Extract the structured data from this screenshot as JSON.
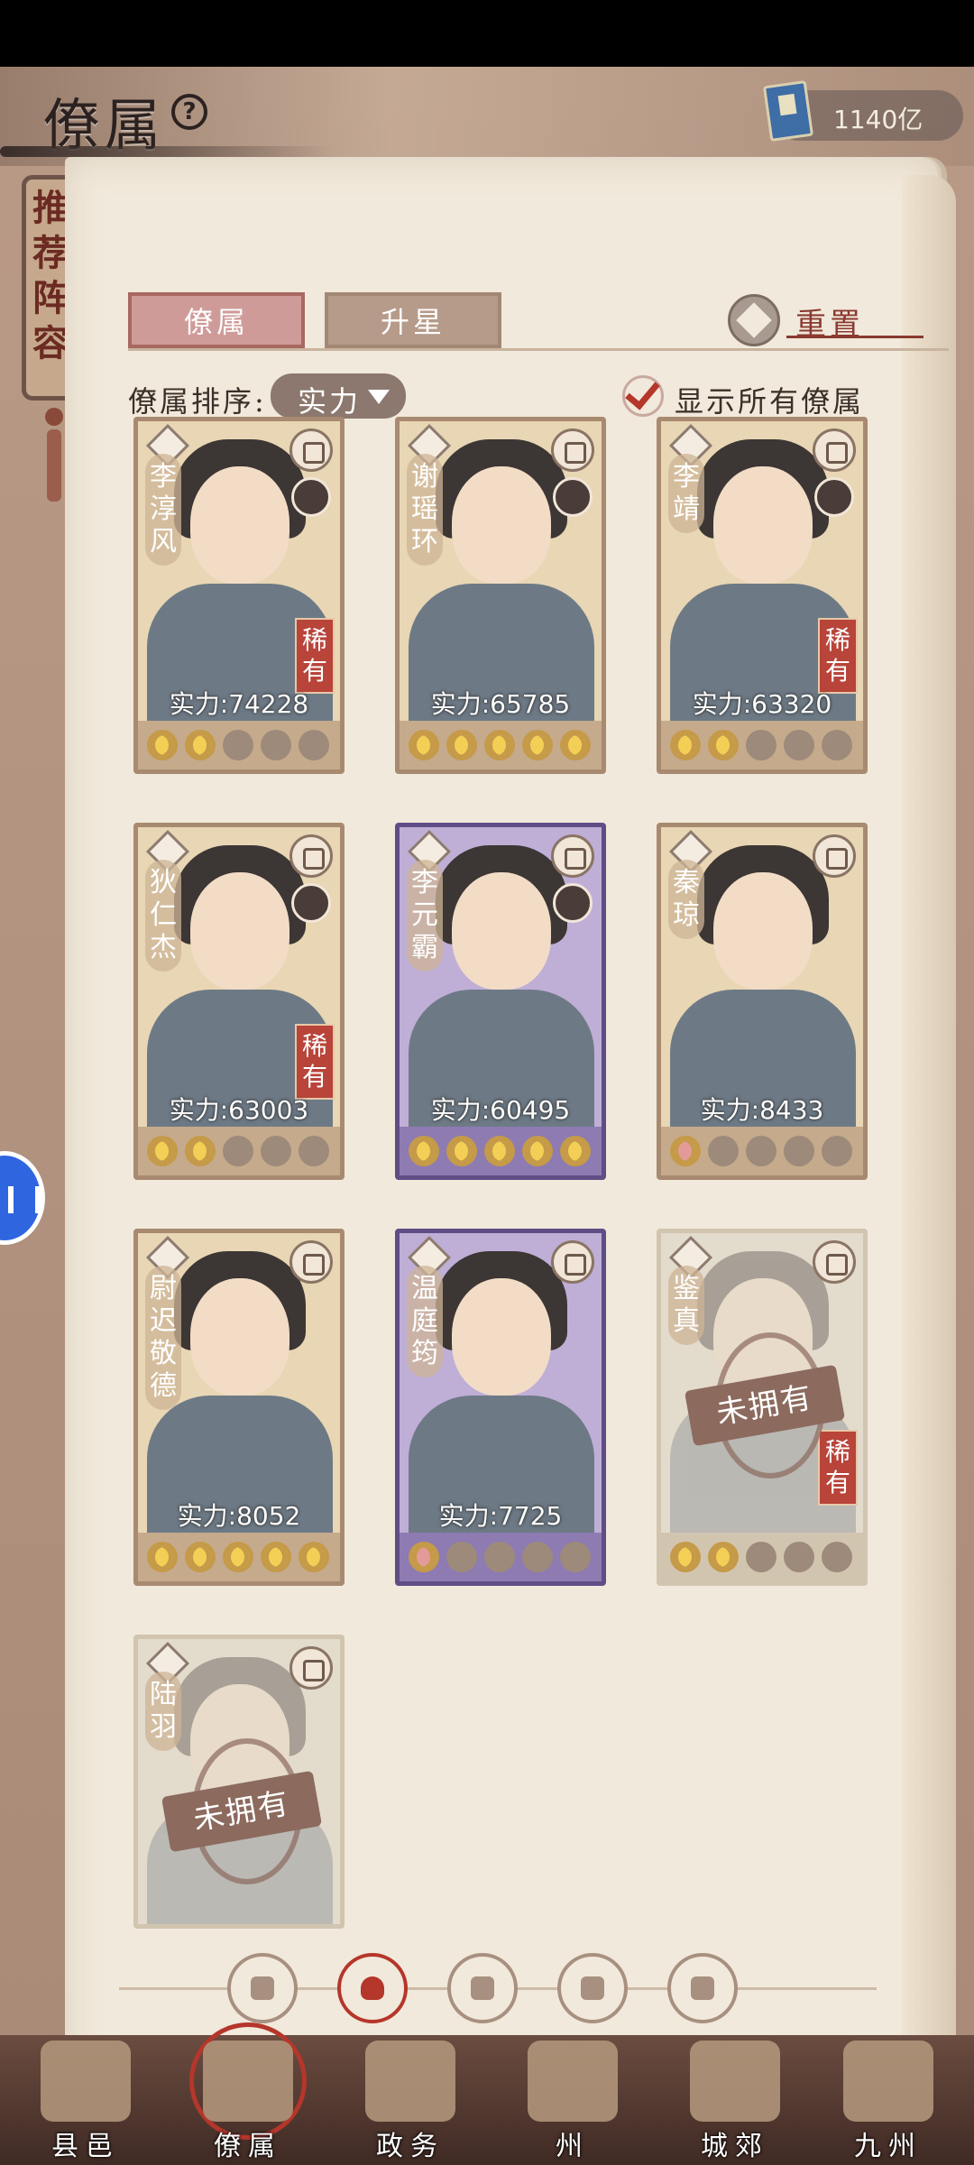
{
  "header": {
    "title": "僚属",
    "help": "?",
    "currency": {
      "icon": "book-icon",
      "value": "1140亿"
    }
  },
  "side_tag": {
    "text": "推荐阵容"
  },
  "tabs": [
    {
      "label": "僚属",
      "active": true
    },
    {
      "label": "升星",
      "active": false
    }
  ],
  "reset": {
    "label": "重置"
  },
  "sort": {
    "label": "僚属排序:",
    "value": "实力"
  },
  "show_all": {
    "label": "显示所有僚属",
    "checked": true
  },
  "cards": [
    {
      "name": "李淳风",
      "power": "实力:74228",
      "rare": "稀有",
      "stars": 2,
      "star_color": "gold",
      "style": "normal",
      "owned": true
    },
    {
      "name": "谢瑶环",
      "power": "实力:65785",
      "rare": "",
      "stars": 5,
      "star_color": "gold",
      "style": "normal",
      "owned": true
    },
    {
      "name": "李靖",
      "power": "实力:63320",
      "rare": "稀有",
      "stars": 2,
      "star_color": "gold",
      "style": "normal",
      "owned": true
    },
    {
      "name": "狄仁杰",
      "power": "实力:63003",
      "rare": "稀有",
      "stars": 2,
      "star_color": "gold",
      "style": "normal",
      "owned": true
    },
    {
      "name": "李元霸",
      "power": "实力:60495",
      "rare": "",
      "stars": 5,
      "star_color": "gold",
      "style": "purple",
      "owned": true
    },
    {
      "name": "秦琼",
      "power": "实力:8433",
      "rare": "",
      "stars": 1,
      "star_color": "pink",
      "style": "normal",
      "owned": true
    },
    {
      "name": "尉迟敬德",
      "power": "实力:8052",
      "rare": "",
      "stars": 5,
      "star_color": "gold",
      "style": "normal",
      "owned": true
    },
    {
      "name": "温庭筠",
      "power": "实力:7725",
      "rare": "",
      "stars": 1,
      "star_color": "pink",
      "style": "purple",
      "owned": true
    },
    {
      "name": "鉴真",
      "power": "",
      "rare": "稀有",
      "stars": 2,
      "star_color": "gold",
      "style": "locked",
      "owned": false,
      "locked_label": "未拥有"
    },
    {
      "name": "陆羽",
      "power": "",
      "rare": "",
      "stars": 0,
      "star_color": "gold",
      "style": "locked",
      "owned": false,
      "locked_label": "未拥有"
    }
  ],
  "filters": [
    {
      "icon": "diamond-icon",
      "active": false
    },
    {
      "icon": "helmet-icon",
      "active": true
    },
    {
      "icon": "scroll-icon",
      "active": false
    },
    {
      "icon": "fan-icon",
      "active": false
    },
    {
      "icon": "lion-icon",
      "active": false
    }
  ],
  "bottom_nav": [
    {
      "label": "县邑",
      "active": false
    },
    {
      "label": "僚属",
      "active": true
    },
    {
      "label": "政务",
      "active": false
    },
    {
      "label": "州",
      "active": false
    },
    {
      "label": "城郊",
      "active": false
    },
    {
      "label": "九州",
      "active": false
    }
  ],
  "colors": {
    "accent": "#b5362b",
    "page": "#f1e9db",
    "gold_star": "#f4cf56",
    "rare": "#b8443a"
  }
}
